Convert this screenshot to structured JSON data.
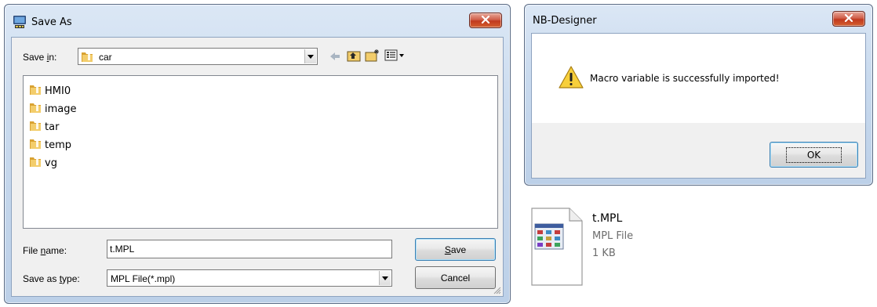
{
  "save_dialog": {
    "title": "Save As",
    "save_in": {
      "label_prefix": "Save ",
      "label_accel": "i",
      "label_suffix": "n:",
      "value": "car"
    },
    "items": [
      {
        "label": "HMI0",
        "icon": "folder-icon"
      },
      {
        "label": "image",
        "icon": "folder-icon"
      },
      {
        "label": "tar",
        "icon": "folder-icon"
      },
      {
        "label": "temp",
        "icon": "folder-icon"
      },
      {
        "label": "vg",
        "icon": "folder-icon"
      }
    ],
    "file_name": {
      "label_prefix": "File ",
      "label_accel": "n",
      "label_suffix": "ame:",
      "value": "t.MPL"
    },
    "save_as_type": {
      "label_prefix": "Save as ",
      "label_accel": "t",
      "label_suffix": "ype:",
      "value": "MPL File(*.mpl)"
    },
    "save_button": {
      "accel": "S",
      "rest": "ave"
    },
    "cancel_button": "Cancel"
  },
  "message_dialog": {
    "title": "NB-Designer",
    "message": "Macro variable is successfully imported!",
    "ok_button": "OK",
    "icon": "warning-icon"
  },
  "file_tile": {
    "name": "t.MPL",
    "type": "MPL File",
    "size": "1 KB",
    "icon": "mpl-file-icon"
  },
  "colors": {
    "window_frame": "#bcd0e8",
    "close_button": "#c1391f",
    "client_bg": "#f0f0f0",
    "folder": "#e8b84a",
    "secondary_text": "#6d6d6d"
  }
}
